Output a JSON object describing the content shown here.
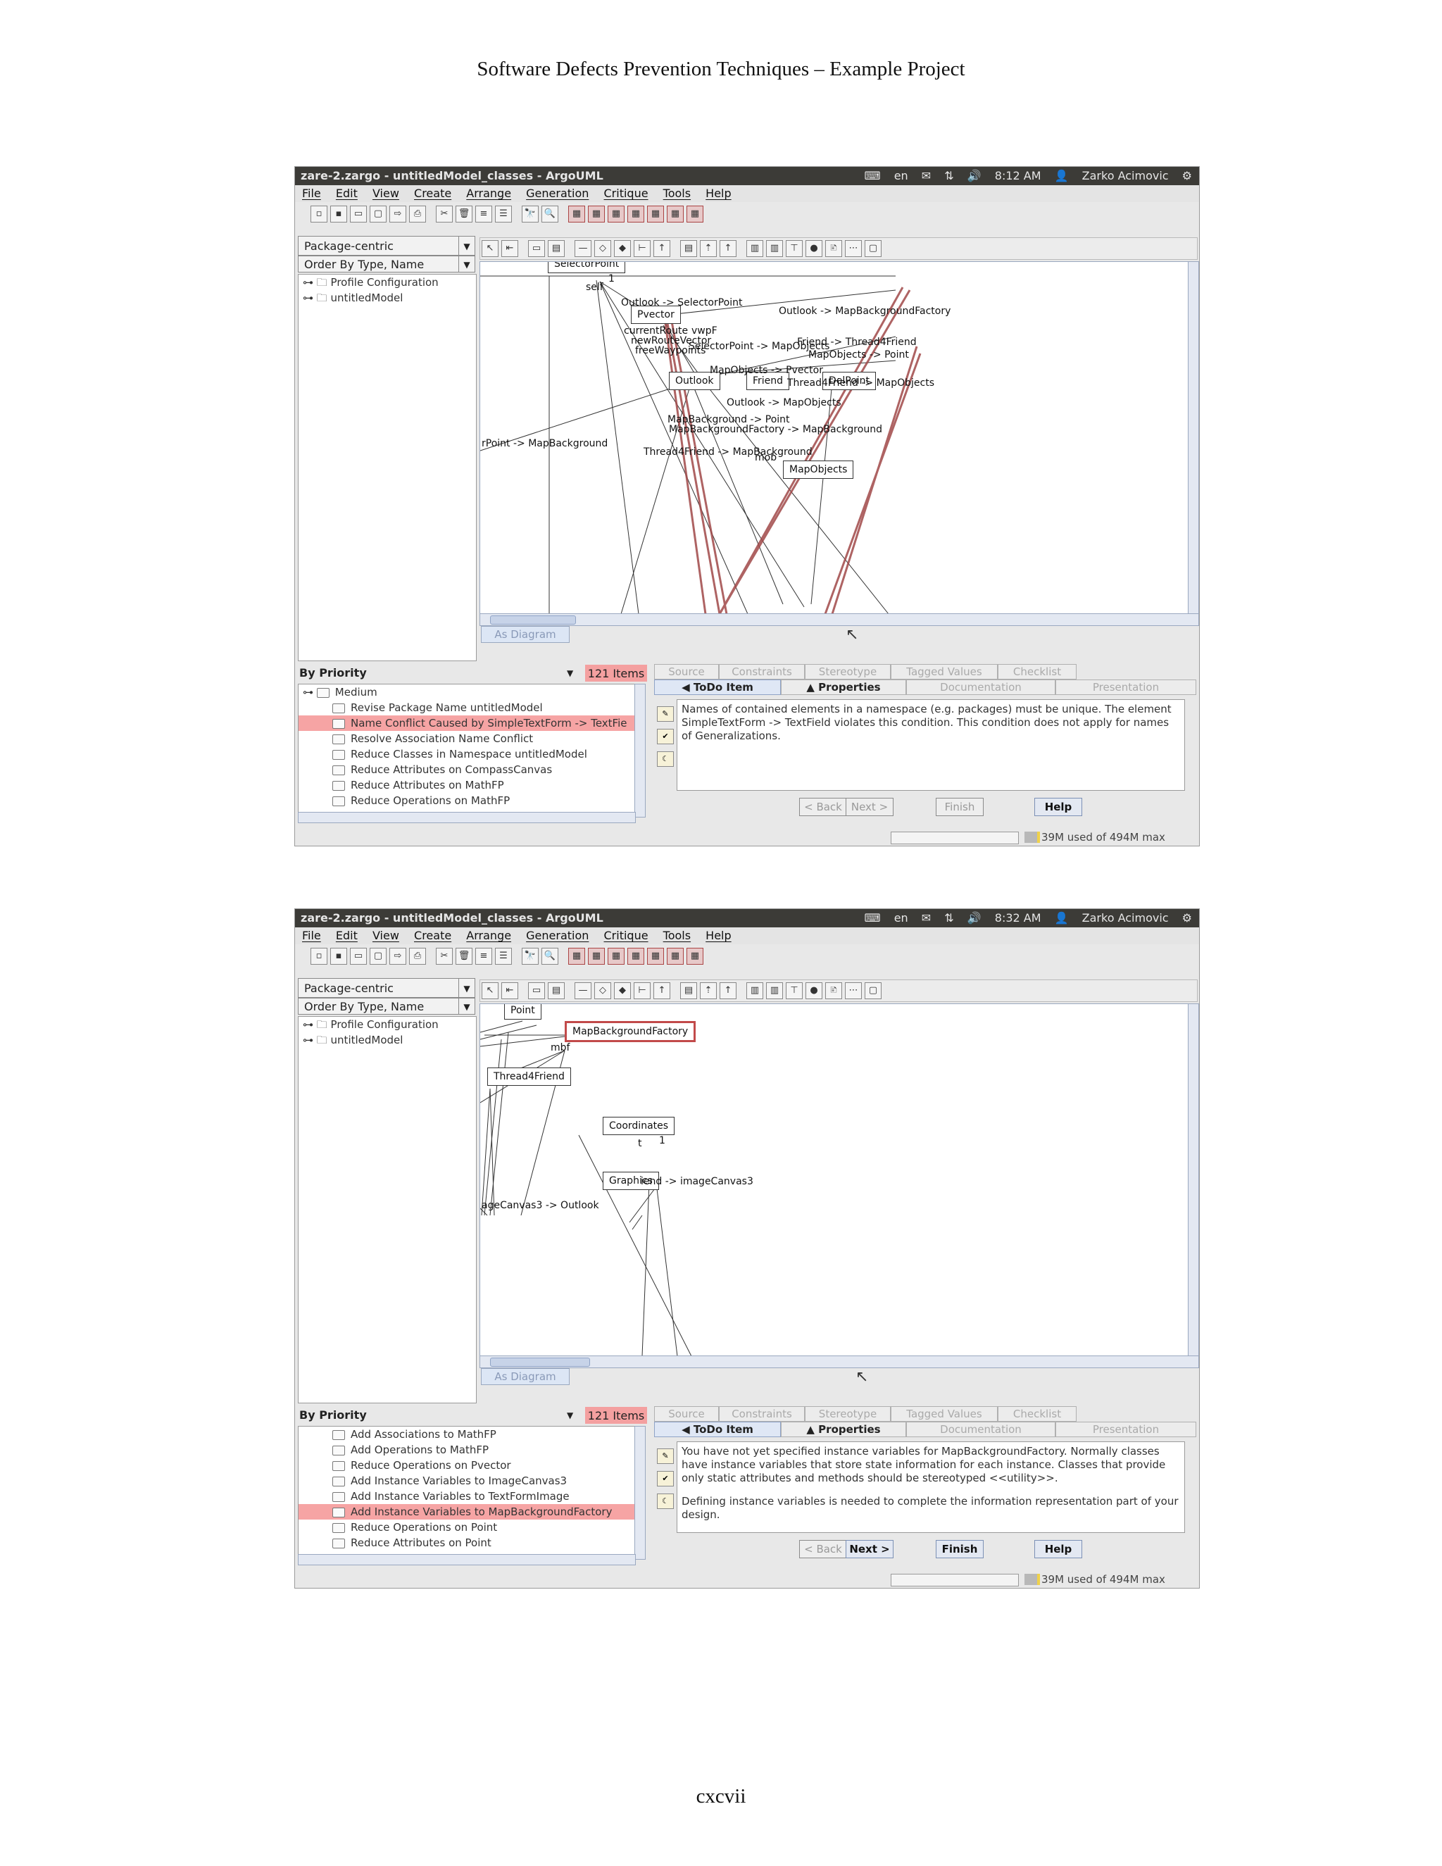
{
  "page": {
    "header": "Software Defects Prevention Techniques – Example Project",
    "footer": "cxcvii"
  },
  "screenshots": [
    {
      "window_title": "zare-2.zargo - untitledModel_classes - ArgoUML",
      "tray": {
        "keyboard": "en",
        "time": "8:12 AM",
        "user": "Zarko Acimovic"
      },
      "menu": [
        "File",
        "Edit",
        "View",
        "Create",
        "Arrange",
        "Generation",
        "Critique",
        "Tools",
        "Help"
      ],
      "perspective": "Package-centric",
      "order_by": "Order By Type, Name",
      "explorer_items": [
        "Profile Configuration",
        "untitledModel"
      ],
      "diagram_tab": "As Diagram",
      "diagram": {
        "nodes": [
          "SelectorPoint",
          "Pvector",
          "Outlook",
          "Friend",
          "DelPoint",
          "MapObjects"
        ],
        "labels": [
          "self",
          "Outlook -> SelectorPoint",
          "Outlook -> MapBackgroundFactory",
          "currentRoute",
          "newRouteVector",
          "freeWaypoints",
          "vwpF",
          "SelectorPoint -> MapObjects",
          "Friend -> Thread4Friend",
          "MapObjects -> Point",
          "MapObjects -> Pvector",
          "Thread4Friend -> MapObjects",
          "Outlook -> MapObjects",
          "MapBackground -> Point",
          "MapBackgroundFactory -> MapBackground",
          "Thread4Friend -> MapBackground",
          "rPoint -> MapBackground",
          "mob",
          "1"
        ]
      },
      "todo": {
        "by": "By Priority",
        "count": "121 Items",
        "group": "Medium",
        "items": [
          "Revise Package Name untitledModel",
          "Name Conflict Caused by SimpleTextForm -> TextFie",
          "Resolve Association Name Conflict",
          "Reduce Classes in Namespace untitledModel",
          "Reduce Attributes on CompassCanvas",
          "Reduce Attributes on MathFP",
          "Reduce Operations on MathFP"
        ]
      },
      "details_tabs_top": [
        "Source",
        "Constraints",
        "Stereotype",
        "Tagged Values",
        "Checklist"
      ],
      "details_tabs_bottom": [
        "ToDo Item",
        "Properties",
        "Documentation",
        "Presentation"
      ],
      "description": [
        "Names of contained elements in a namespace (e.g. packages) must be unique. The element SimpleTextForm -> TextField violates this condition. This condition does not apply for names of Generalizations."
      ],
      "buttons": [
        "< Back",
        "Next >",
        "Finish",
        "Help"
      ],
      "memory": "39M used of 494M max"
    },
    {
      "window_title": "zare-2.zargo - untitledModel_classes - ArgoUML",
      "tray": {
        "keyboard": "en",
        "time": "8:32 AM",
        "user": "Zarko Acimovic"
      },
      "menu": [
        "File",
        "Edit",
        "View",
        "Create",
        "Arrange",
        "Generation",
        "Critique",
        "Tools",
        "Help"
      ],
      "perspective": "Package-centric",
      "order_by": "Order By Type, Name",
      "explorer_items": [
        "Profile Configuration",
        "untitledModel"
      ],
      "diagram_tab": "As Diagram",
      "diagram": {
        "nodes": [
          "Point",
          "MapBackgroundFactory",
          "Thread4Friend",
          "Coordinates",
          "Graphics"
        ],
        "labels": [
          "mbf",
          "iend -> imageCanvas3",
          "ageCanvas3 -> Outlook",
          "1",
          "t"
        ]
      },
      "todo": {
        "by": "By Priority",
        "count": "121 Items",
        "items": [
          "Add Associations to MathFP",
          "Add Operations to MathFP",
          "Reduce Operations on Pvector",
          "Add Instance Variables to ImageCanvas3",
          "Add Instance Variables to TextFormImage",
          "Add Instance Variables to MapBackgroundFactory",
          "Reduce Operations on Point",
          "Reduce Attributes on Point"
        ]
      },
      "details_tabs_top": [
        "Source",
        "Constraints",
        "Stereotype",
        "Tagged Values",
        "Checklist"
      ],
      "details_tabs_bottom": [
        "ToDo Item",
        "Properties",
        "Documentation",
        "Presentation"
      ],
      "description": [
        "You have not yet specified instance variables for MapBackgroundFactory. Normally classes have instance variables that store state information for each instance. Classes that provide only static attributes and methods should be stereotyped <<utility>>.",
        "Defining instance variables is needed to complete the information representation part of your design."
      ],
      "buttons": [
        "< Back",
        "Next >",
        "Finish",
        "Help"
      ],
      "memory": "39M used of 494M max"
    }
  ]
}
